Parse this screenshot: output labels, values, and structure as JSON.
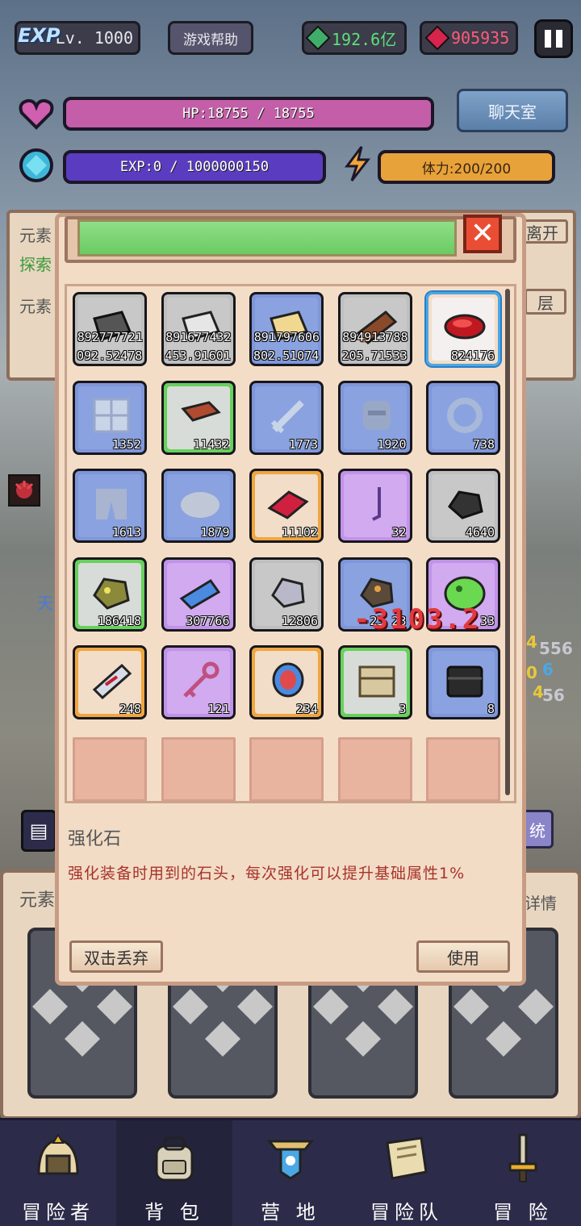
{
  "top": {
    "exp_badge": "EXP",
    "level": "Lv. 1000",
    "help_button": "游戏帮助",
    "gold": "192.6亿",
    "gems": "905935",
    "pause_icon": "pause-icon"
  },
  "stats": {
    "hp": "HP:18755 / 18755",
    "exp": "EXP:0 / 1000000150",
    "stamina": "体力:200/200",
    "chat_button": "聊天室"
  },
  "background": {
    "label_element": "元素",
    "label_explore": "探索",
    "label_element2": "元素",
    "leave": "离开",
    "floor": "层",
    "sky": "天",
    "bottom_title": "元素",
    "details": "详情",
    "system": "统"
  },
  "inventory": {
    "rows": [
      [
        {
          "rarity": "gray",
          "icon": "iron-ingot-icon",
          "count": "892777721",
          "count2": "092.52478"
        },
        {
          "rarity": "gray",
          "icon": "silver-ingot-icon",
          "count": "891677432",
          "count2": "453.91601"
        },
        {
          "rarity": "blue",
          "icon": "gold-ingot-icon",
          "count": "891797606",
          "count2": "802.51074"
        },
        {
          "rarity": "gray",
          "icon": "wood-log-icon",
          "count": "894913788",
          "count2": "205.71533"
        },
        {
          "rarity": "sel",
          "icon": "enhance-stone-icon",
          "count": "824176"
        }
      ],
      [
        {
          "rarity": "blue",
          "icon": "shield-icon",
          "count": "1352"
        },
        {
          "rarity": "green",
          "icon": "brick-icon",
          "count": "11432"
        },
        {
          "rarity": "blue",
          "icon": "sword-icon",
          "count": "1773"
        },
        {
          "rarity": "blue",
          "icon": "helmet-icon",
          "count": "1920"
        },
        {
          "rarity": "blue",
          "icon": "ring-icon",
          "count": "738"
        }
      ],
      [
        {
          "rarity": "blue",
          "icon": "pants-icon",
          "count": "1613"
        },
        {
          "rarity": "blue",
          "icon": "cloud-icon",
          "count": "1879"
        },
        {
          "rarity": "orange",
          "icon": "red-gem-icon",
          "count": "11102"
        },
        {
          "rarity": "purple",
          "icon": "wand-icon",
          "count": "32"
        },
        {
          "rarity": "gray",
          "icon": "coal-icon",
          "count": "4640"
        }
      ],
      [
        {
          "rarity": "green",
          "icon": "gold-ore-icon",
          "count": "186418"
        },
        {
          "rarity": "purple",
          "icon": "blue-crystal-icon",
          "count": "307766"
        },
        {
          "rarity": "gray",
          "icon": "silver-ore-icon",
          "count": "12806"
        },
        {
          "rarity": "blue",
          "icon": "copper-ore-icon",
          "count": "-23 23"
        },
        {
          "rarity": "purple",
          "icon": "slime-icon",
          "count": "33"
        }
      ],
      [
        {
          "rarity": "orange",
          "icon": "scroll-icon",
          "count": "248"
        },
        {
          "rarity": "purple",
          "icon": "key-icon",
          "count": "121"
        },
        {
          "rarity": "orange",
          "icon": "rainbow-orb-icon",
          "count": "234"
        },
        {
          "rarity": "green",
          "icon": "wooden-chest-icon",
          "count": "3"
        },
        {
          "rarity": "blue",
          "icon": "dark-chest-icon",
          "count": "8"
        }
      ]
    ],
    "floating_damage": "-3103.2"
  },
  "selected_item": {
    "name": "强化石",
    "description": "强化装备时用到的石头，每次强化可以提升基础属性1%",
    "discard_button": "双击丢弃",
    "use_button": "使用"
  },
  "side_numbers": [
    "4",
    "556",
    "0",
    "6",
    "4",
    "4",
    "56"
  ],
  "nav": {
    "items": [
      {
        "label": "冒险者",
        "icon": "adventurer-helmet-icon"
      },
      {
        "label": "背 包",
        "icon": "backpack-icon"
      },
      {
        "label": "营 地",
        "icon": "camp-banner-icon"
      },
      {
        "label": "冒险队",
        "icon": "team-book-icon"
      },
      {
        "label": "冒 险",
        "icon": "sword-adventure-icon"
      }
    ]
  },
  "colors": {
    "hp_bar": "#c45ea8",
    "exp_bar": "#5a3cc0",
    "stamina_bar": "#e8a23a",
    "modal_bg": "#f2dcc6",
    "desc_text": "#a8322a"
  }
}
